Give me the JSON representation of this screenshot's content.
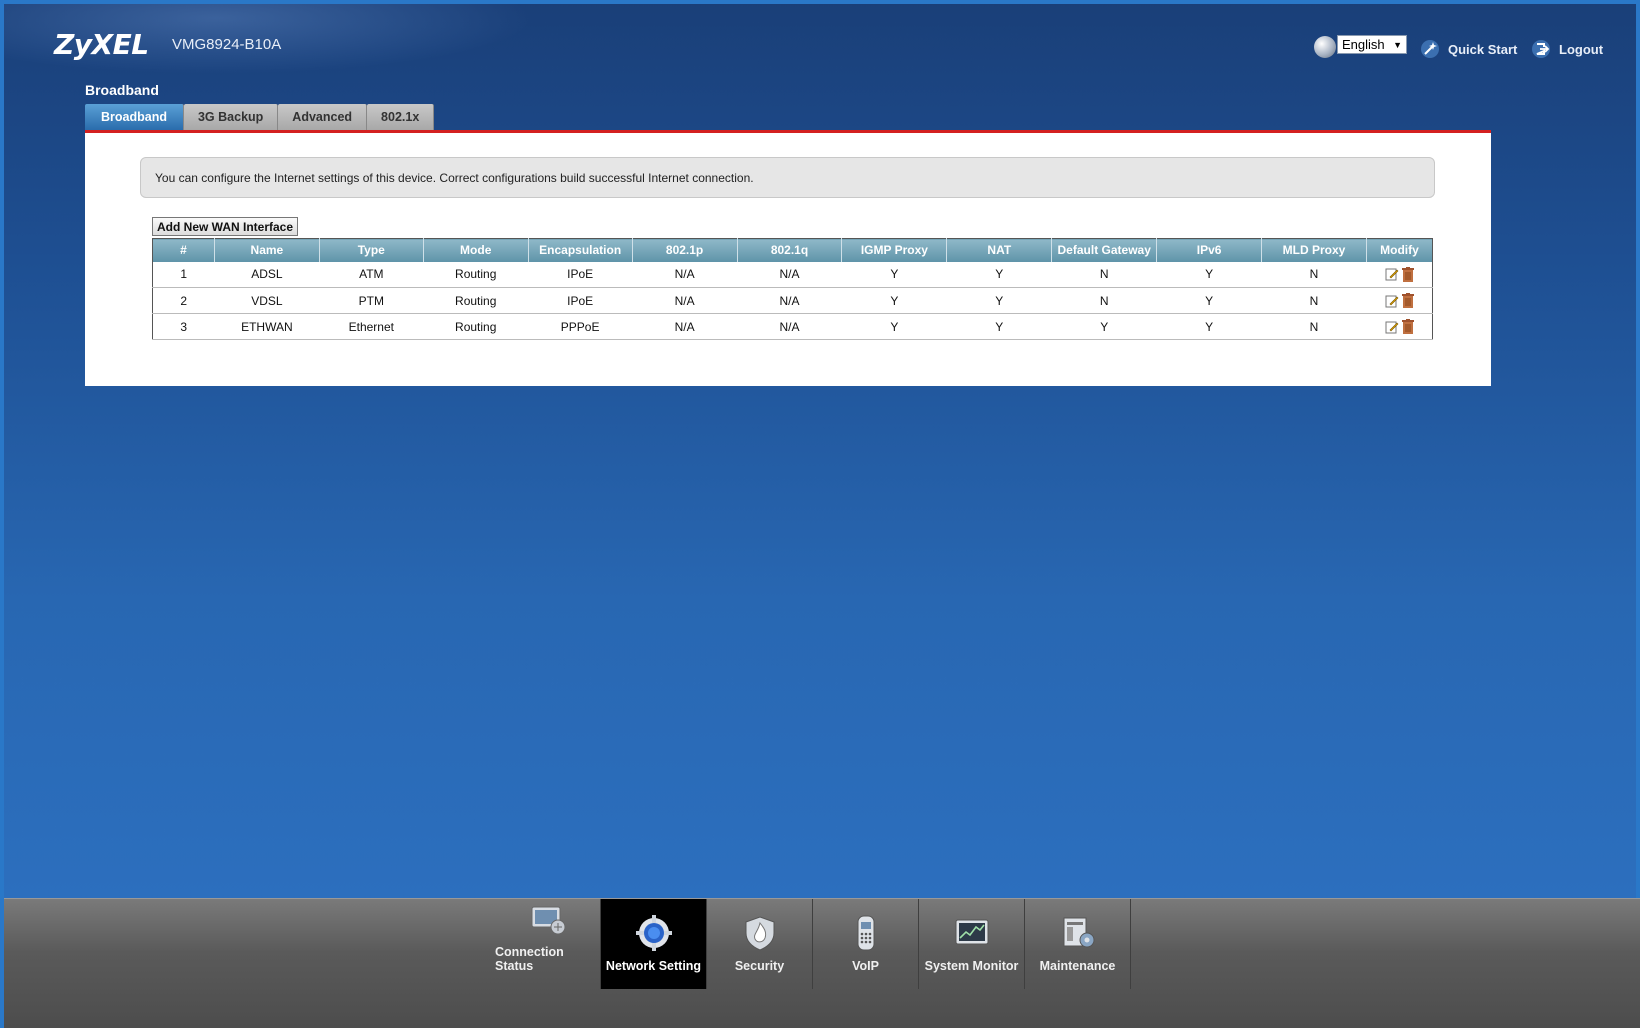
{
  "header": {
    "logo": "ZyXEL",
    "model": "VMG8924-B10A",
    "language": "English",
    "quick_start": "Quick Start",
    "logout": "Logout"
  },
  "page": {
    "title": "Broadband",
    "tabs": [
      "Broadband",
      "3G Backup",
      "Advanced",
      "802.1x"
    ],
    "active_tab": "Broadband",
    "info": "You can configure the Internet settings of this device. Correct configurations build successful Internet connection.",
    "add_button": "Add New WAN Interface"
  },
  "table": {
    "headers": [
      "#",
      "Name",
      "Type",
      "Mode",
      "Encapsulation",
      "802.1p",
      "802.1q",
      "IGMP Proxy",
      "NAT",
      "Default Gateway",
      "IPv6",
      "MLD Proxy",
      "Modify"
    ],
    "rows": [
      [
        "1",
        "ADSL",
        "ATM",
        "Routing",
        "IPoE",
        "N/A",
        "N/A",
        "Y",
        "Y",
        "N",
        "Y",
        "N"
      ],
      [
        "2",
        "VDSL",
        "PTM",
        "Routing",
        "IPoE",
        "N/A",
        "N/A",
        "Y",
        "Y",
        "N",
        "Y",
        "N"
      ],
      [
        "3",
        "ETHWAN",
        "Ethernet",
        "Routing",
        "PPPoE",
        "N/A",
        "N/A",
        "Y",
        "Y",
        "Y",
        "Y",
        "N"
      ]
    ]
  },
  "nav": {
    "items": [
      {
        "label": "Connection Status",
        "icon": "monitor-icon"
      },
      {
        "label": "Network Setting",
        "icon": "gear-icon"
      },
      {
        "label": "Security",
        "icon": "shield-icon"
      },
      {
        "label": "VoIP",
        "icon": "phone-icon"
      },
      {
        "label": "System Monitor",
        "icon": "chart-icon"
      },
      {
        "label": "Maintenance",
        "icon": "tools-icon"
      }
    ],
    "active": "Network Setting"
  },
  "colors": {
    "accent_red": "#d42020",
    "tab_active": "#2a6cac",
    "table_header": "#5e93a8"
  }
}
